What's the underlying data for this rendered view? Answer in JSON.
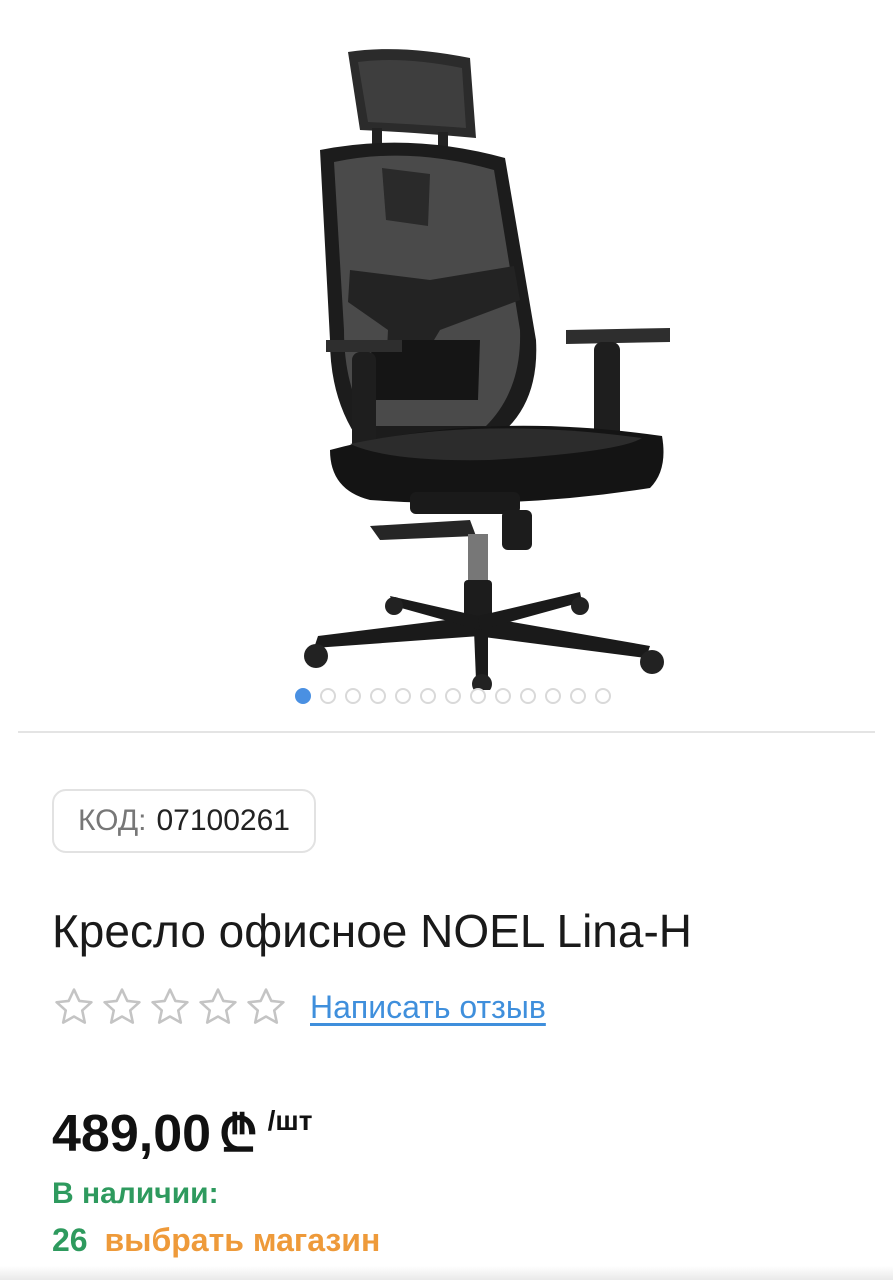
{
  "gallery": {
    "image_alt": "chair-product-image",
    "slide_count": 13,
    "active_slide": 1
  },
  "product": {
    "code_label": "КОД:",
    "code_value": "07100261",
    "title": "Кресло офисное NOEL Lina-H",
    "rating_stars_filled": 0,
    "rating_stars_total": 5,
    "review_link": "Написать отзыв"
  },
  "price": {
    "amount": "489,00",
    "currency_symbol": "₾",
    "unit": "/шт"
  },
  "stock": {
    "label": "В наличии:",
    "count": "26",
    "choose_store": "выбрать магазин"
  },
  "colors": {
    "accent_blue": "#3f8fdc",
    "in_stock_green": "#2e9a5e",
    "store_orange": "#ee9a3a"
  }
}
